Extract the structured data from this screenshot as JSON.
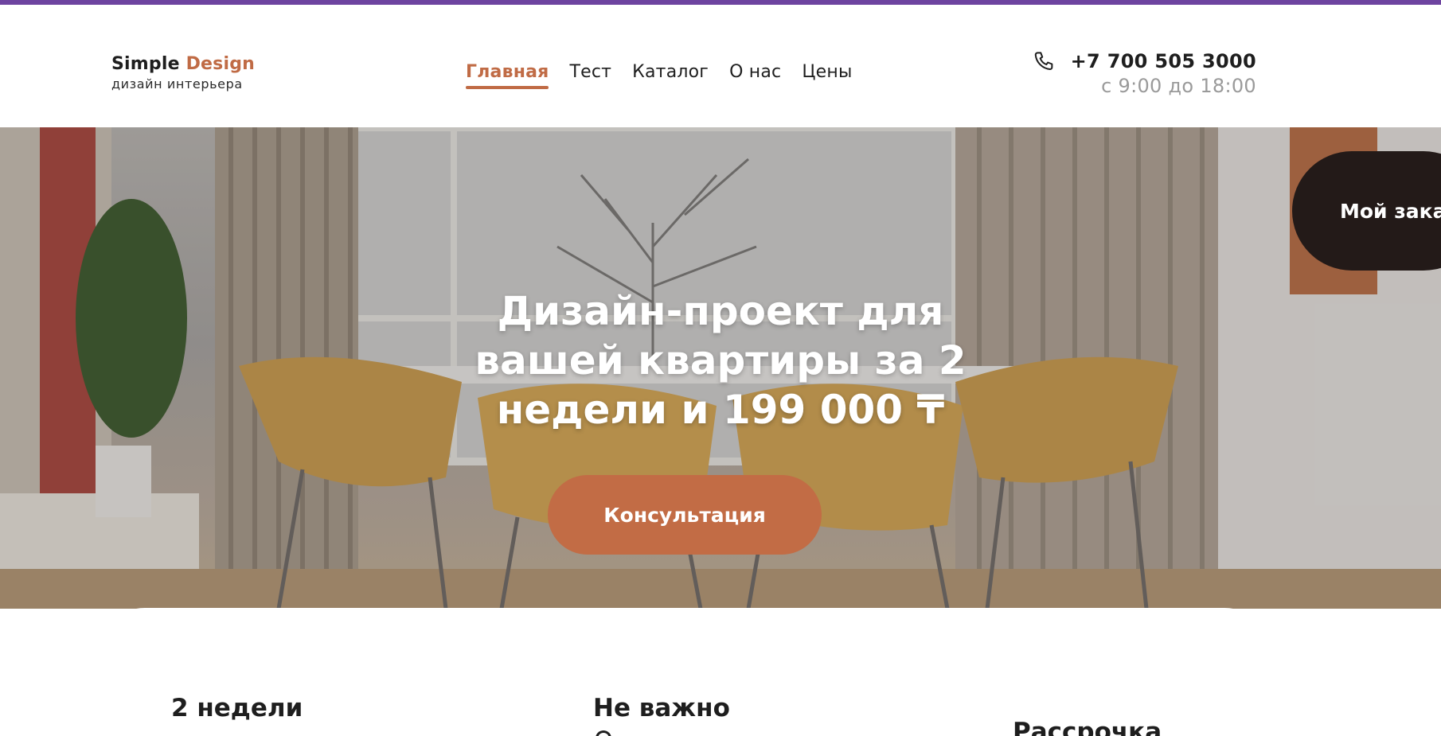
{
  "brand": {
    "name_part1": "Simple ",
    "name_part2": "Design",
    "tagline": "дизайн интерьера"
  },
  "nav": {
    "items": [
      {
        "label": "Главная",
        "active": true
      },
      {
        "label": "Тест",
        "active": false
      },
      {
        "label": "Каталог",
        "active": false
      },
      {
        "label": "О нас",
        "active": false
      },
      {
        "label": "Цены",
        "active": false
      }
    ]
  },
  "contact": {
    "phone": "+7 700 505 3000",
    "hours": "с 9:00 до 18:00",
    "icon": "phone-icon"
  },
  "hero": {
    "title": "Дизайн-проект для вашей квартиры за 2 недели и 199 000 ₸",
    "cta_label": "Консультация"
  },
  "floating": {
    "order_label": "Мой заказ"
  },
  "features": {
    "item1": "2 недели",
    "item2": "Не важно",
    "item3": "Рассрочка"
  },
  "colors": {
    "accent": "#c06b45",
    "topbar": "#6e44a0",
    "dark": "#231a18"
  }
}
